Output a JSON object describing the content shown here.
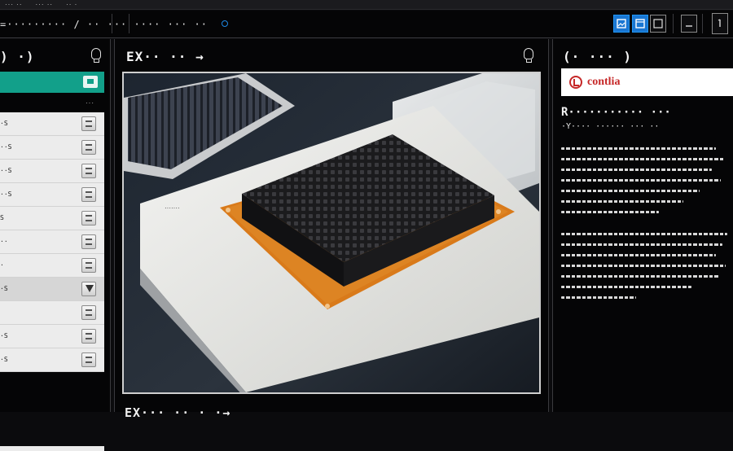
{
  "menubar": {
    "items": [
      "··· ··",
      "··· ··",
      "·· ·"
    ]
  },
  "toolbar": {
    "path_text": "=········· / ·· ··· ···· ··· ··",
    "buttons": [
      "image-view",
      "panel-view",
      "window",
      "minimize",
      "maximize"
    ]
  },
  "left_panel": {
    "title": ") ·)",
    "header_right": "···",
    "rows": [
      {
        "label": "·S",
        "selected": false
      },
      {
        "label": "··S",
        "selected": false
      },
      {
        "label": "··S",
        "selected": false
      },
      {
        "label": "··S",
        "selected": false
      },
      {
        "label": "S",
        "selected": false
      },
      {
        "label": "··",
        "selected": false
      },
      {
        "label": "·",
        "selected": false
      },
      {
        "label": "·S",
        "selected": true
      },
      {
        "label": "",
        "selected": false
      },
      {
        "label": "·S",
        "selected": false
      },
      {
        "label": "·S",
        "selected": false
      }
    ]
  },
  "center_panel": {
    "title": "EX·· ·· →",
    "image_label": "EX··· ·· · ·→",
    "board_marking": "·······"
  },
  "right_panel": {
    "title": "(· ··· )",
    "brand": "contlia",
    "heading": "R··········· ···",
    "subheading": "·Y···· ······ ··· ··"
  },
  "colors": {
    "accent_teal": "#12a08a",
    "accent_blue": "#1976d2",
    "brand_red": "#c62828",
    "pcb_orange": "#d97a1a"
  }
}
